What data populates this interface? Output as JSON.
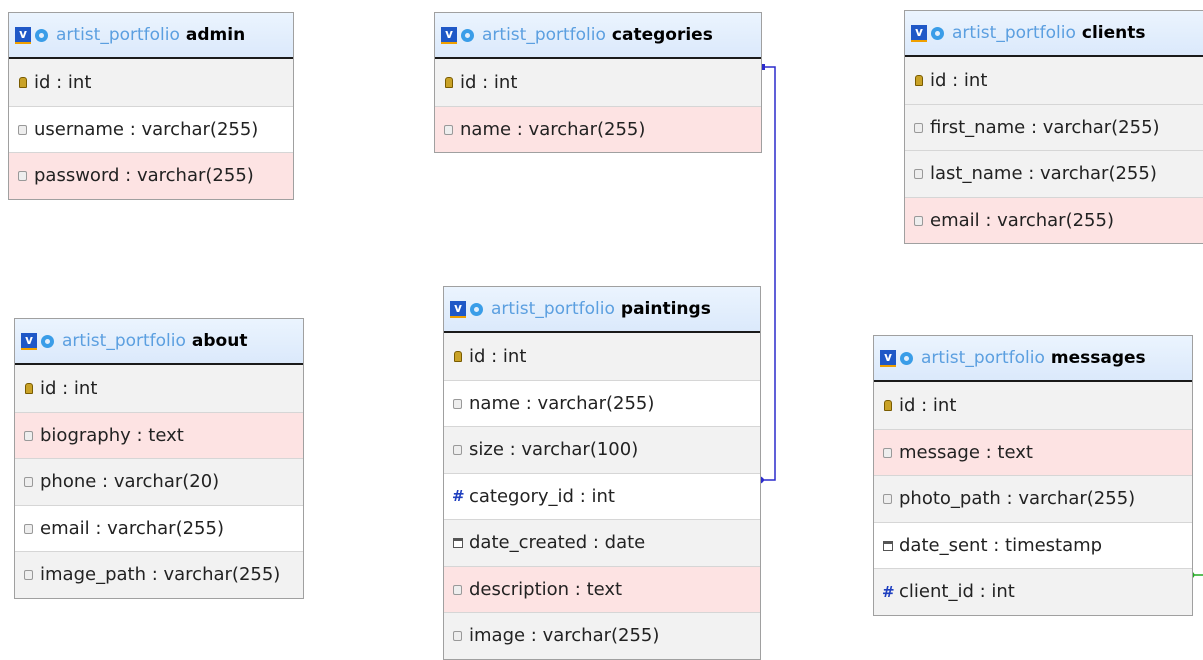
{
  "database": "artist_portfolio",
  "tables": [
    {
      "id": "admin",
      "name": "admin",
      "columns": [
        {
          "label": "id : int",
          "icon": "key-icon",
          "style": "normal"
        },
        {
          "label": "username : varchar(255)",
          "icon": "column-icon",
          "style": "white"
        },
        {
          "label": "password : varchar(255)",
          "icon": "column-icon",
          "style": "highlight"
        }
      ]
    },
    {
      "id": "categories",
      "name": "categories",
      "columns": [
        {
          "label": "id : int",
          "icon": "key-icon",
          "style": "normal"
        },
        {
          "label": "name : varchar(255)",
          "icon": "column-icon",
          "style": "highlight"
        }
      ]
    },
    {
      "id": "clients",
      "name": "clients",
      "columns": [
        {
          "label": "id : int",
          "icon": "key-icon",
          "style": "normal"
        },
        {
          "label": "first_name : varchar(255)",
          "icon": "column-icon",
          "style": "normal"
        },
        {
          "label": "last_name : varchar(255)",
          "icon": "column-icon",
          "style": "normal"
        },
        {
          "label": "email : varchar(255)",
          "icon": "column-icon",
          "style": "highlight"
        }
      ]
    },
    {
      "id": "about",
      "name": "about",
      "columns": [
        {
          "label": "id : int",
          "icon": "key-icon",
          "style": "normal"
        },
        {
          "label": "biography : text",
          "icon": "column-icon",
          "style": "highlight"
        },
        {
          "label": "phone : varchar(20)",
          "icon": "column-icon",
          "style": "normal"
        },
        {
          "label": "email : varchar(255)",
          "icon": "column-icon",
          "style": "white"
        },
        {
          "label": "image_path : varchar(255)",
          "icon": "column-icon",
          "style": "normal"
        }
      ]
    },
    {
      "id": "paintings",
      "name": "paintings",
      "columns": [
        {
          "label": "id : int",
          "icon": "key-icon",
          "style": "normal"
        },
        {
          "label": "name : varchar(255)",
          "icon": "column-icon",
          "style": "white"
        },
        {
          "label": "size : varchar(100)",
          "icon": "column-icon",
          "style": "normal"
        },
        {
          "label": "category_id : int",
          "icon": "number-icon",
          "style": "white"
        },
        {
          "label": "date_created : date",
          "icon": "date-icon",
          "style": "normal"
        },
        {
          "label": "description : text",
          "icon": "column-icon",
          "style": "highlight"
        },
        {
          "label": "image : varchar(255)",
          "icon": "column-icon",
          "style": "normal"
        }
      ]
    },
    {
      "id": "messages",
      "name": "messages",
      "columns": [
        {
          "label": "id : int",
          "icon": "key-icon",
          "style": "normal"
        },
        {
          "label": "message : text",
          "icon": "column-icon",
          "style": "highlight"
        },
        {
          "label": "photo_path : varchar(255)",
          "icon": "column-icon",
          "style": "normal"
        },
        {
          "label": "date_sent : timestamp",
          "icon": "date-icon",
          "style": "white"
        },
        {
          "label": "client_id : int",
          "icon": "number-icon",
          "style": "normal"
        }
      ]
    }
  ],
  "relations": [
    {
      "from": "paintings.category_id",
      "to": "categories.id",
      "color": "#2b2bcc"
    },
    {
      "from": "messages.client_id",
      "to": "clients.id",
      "color": "#22aa22"
    }
  ]
}
